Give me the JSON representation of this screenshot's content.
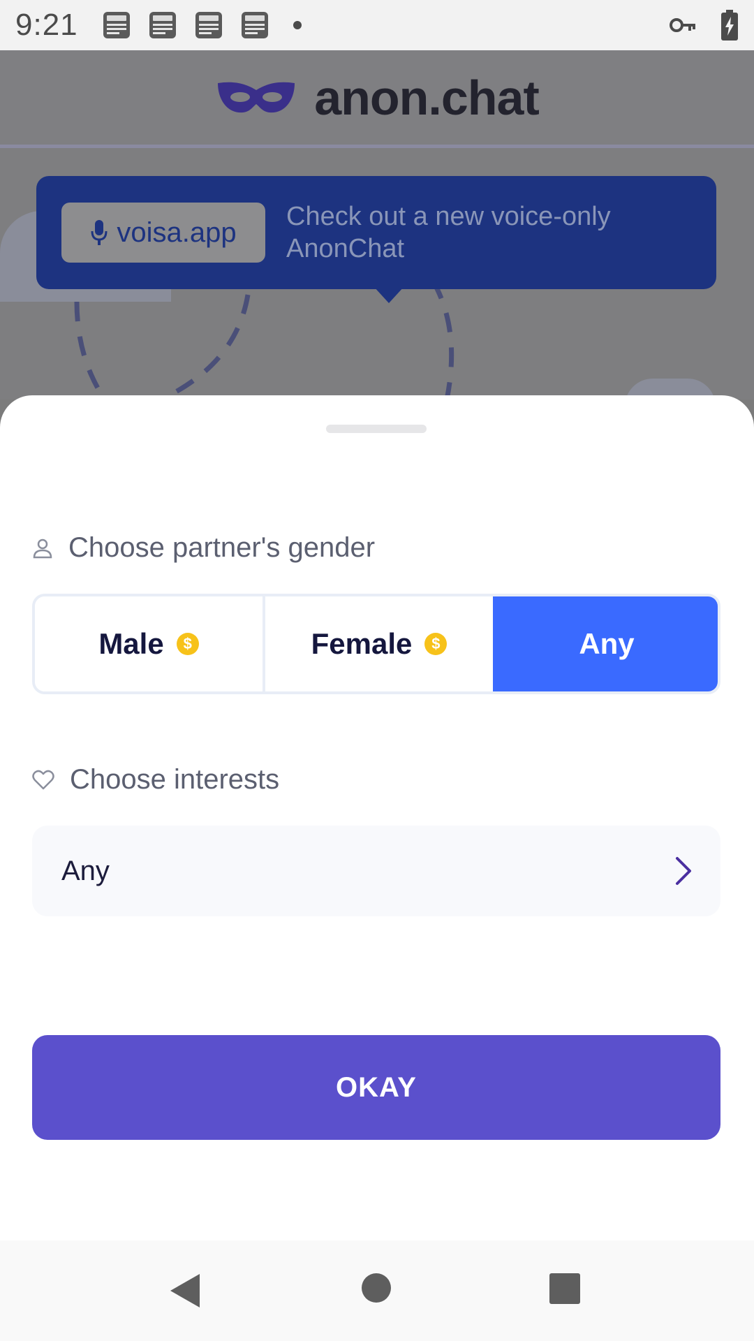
{
  "status_bar": {
    "time": "9:21",
    "notification_icons": [
      "local-news-icon",
      "local-news-icon",
      "local-news-icon",
      "local-news-icon"
    ],
    "right_icons": [
      "vpn-key-icon",
      "battery-charging-icon"
    ]
  },
  "app": {
    "name": "anon.chat",
    "logo_icon": "mask-icon"
  },
  "promo": {
    "chip_label": "voisa.app",
    "chip_icon": "microphone-icon",
    "text": "Check out a new voice-only AnonChat"
  },
  "sheet": {
    "gender_section": {
      "label": "Choose partner's gender",
      "icon": "person-icon",
      "options": [
        {
          "label": "Male",
          "premium": true,
          "selected": false
        },
        {
          "label": "Female",
          "premium": true,
          "selected": false
        },
        {
          "label": "Any",
          "premium": false,
          "selected": true
        }
      ]
    },
    "interests_section": {
      "label": "Choose interests",
      "icon": "heart-icon",
      "value": "Any"
    },
    "okay_label": "OKAY"
  },
  "colors": {
    "accent_blue": "#3a6aff",
    "button_purple": "#5b50cc",
    "coin_yellow": "#f7c21a",
    "banner_blue": "#1d3380"
  },
  "nav_bar": {
    "buttons": [
      "back-icon",
      "home-icon",
      "recents-icon"
    ]
  }
}
